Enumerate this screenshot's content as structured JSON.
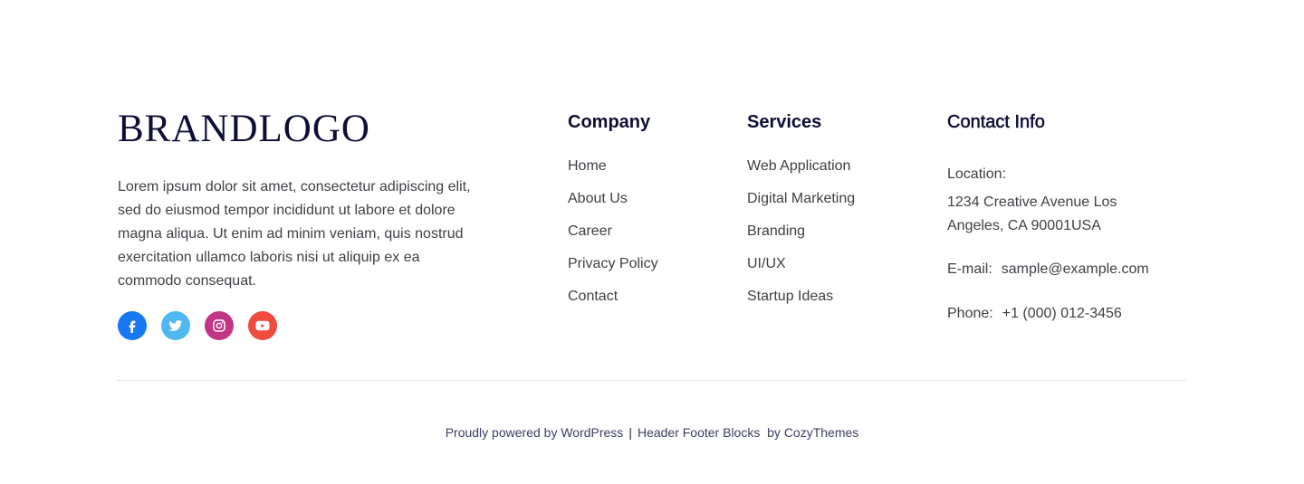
{
  "brand": {
    "logo_text": "BRANDLOGO",
    "description": "Lorem ipsum dolor sit amet, consectetur adipiscing elit, sed do eiusmod tempor incididunt ut labore et dolore magna aliqua. Ut enim ad minim veniam, quis nostrud exercitation ullamco laboris nisi ut aliquip ex ea commodo consequat."
  },
  "socials": [
    {
      "icon": "facebook-icon",
      "color": "#1877f2"
    },
    {
      "icon": "twitter-icon",
      "color": "#4fb8f0"
    },
    {
      "icon": "instagram-icon",
      "color": "#c13584"
    },
    {
      "icon": "youtube-icon",
      "color": "#ef4b3f"
    }
  ],
  "company": {
    "heading": "Company",
    "links": [
      "Home",
      "About Us",
      "Career",
      "Privacy Policy",
      "Contact"
    ]
  },
  "services": {
    "heading": "Services",
    "links": [
      "Web Application",
      "Digital Marketing",
      "Branding",
      "UI/UX",
      "Startup Ideas"
    ]
  },
  "contact": {
    "heading": "Contact Info",
    "location_label": "Location:",
    "location_value": "1234 Creative Avenue Los Angeles, CA 90001USA",
    "email_label": "E-mail:",
    "email_value": "sample@example.com",
    "phone_label": "Phone:",
    "phone_value": "+1 (000) 012-3456"
  },
  "credits": {
    "powered": "Proudly powered by WordPress",
    "separator": "|",
    "blocks": "Header Footer Blocks",
    "by": "by CozyThemes"
  },
  "colors": {
    "heading": "#0d0f33",
    "text": "#3f3f46",
    "divider": "#e6e6ea"
  }
}
